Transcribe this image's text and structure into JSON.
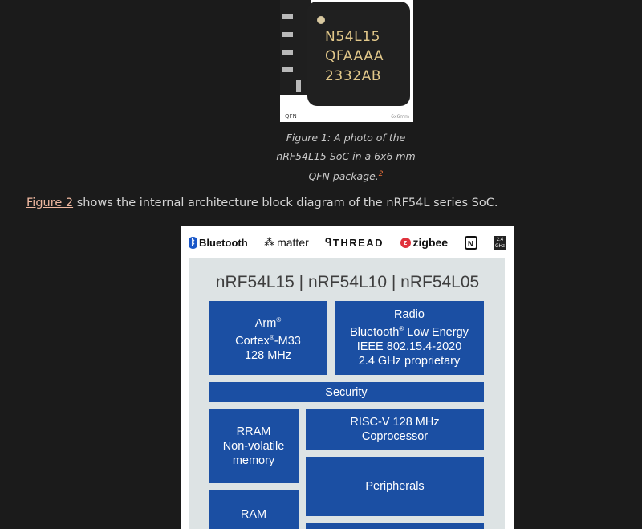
{
  "figure1": {
    "chip_marking": [
      "N54L15",
      "QFAAAA",
      "2332AB"
    ],
    "package_label": "QFN",
    "size_label": "6x6mm",
    "caption_lines": [
      "Figure 1: A photo of the",
      "nRF54L15 SoC in a 6x6 mm",
      "QFN package."
    ],
    "footnote": "2"
  },
  "paragraph": {
    "link_text": "Figure 2",
    "text": " shows the internal architecture block diagram of the nRF54L series SoC."
  },
  "diagram": {
    "logos": {
      "bluetooth": "Bluetooth",
      "bluetooth_icon": "ᛒ",
      "matter": "matter",
      "thread": "THREAD",
      "zigbee": "zigbee",
      "zigbee_icon": "z",
      "nfc": "N",
      "ghz": [
        "2.4",
        "GHz"
      ]
    },
    "title": "nRF54L15 | nRF54L10 | nRF54L05",
    "blocks": {
      "cpu": [
        "Arm",
        "Cortex",
        "-M33",
        "128 MHz"
      ],
      "radio": [
        "Radio",
        "Bluetooth",
        " Low Energy",
        "IEEE 802.15.4-2020",
        "2.4 GHz proprietary"
      ],
      "security": "Security",
      "rram": [
        "RRAM",
        "Non-volatile",
        "memory"
      ],
      "riscv": [
        "RISC-V 128 MHz",
        "Coprocessor"
      ],
      "peripherals": "Peripherals",
      "ram": "RAM"
    },
    "registered_mark": "®"
  },
  "colors": {
    "page_bg": "#1b1b1b",
    "link": "#f0b8a0",
    "block_blue": "#1b4fa3",
    "panel_grey": "#dde3e4"
  }
}
